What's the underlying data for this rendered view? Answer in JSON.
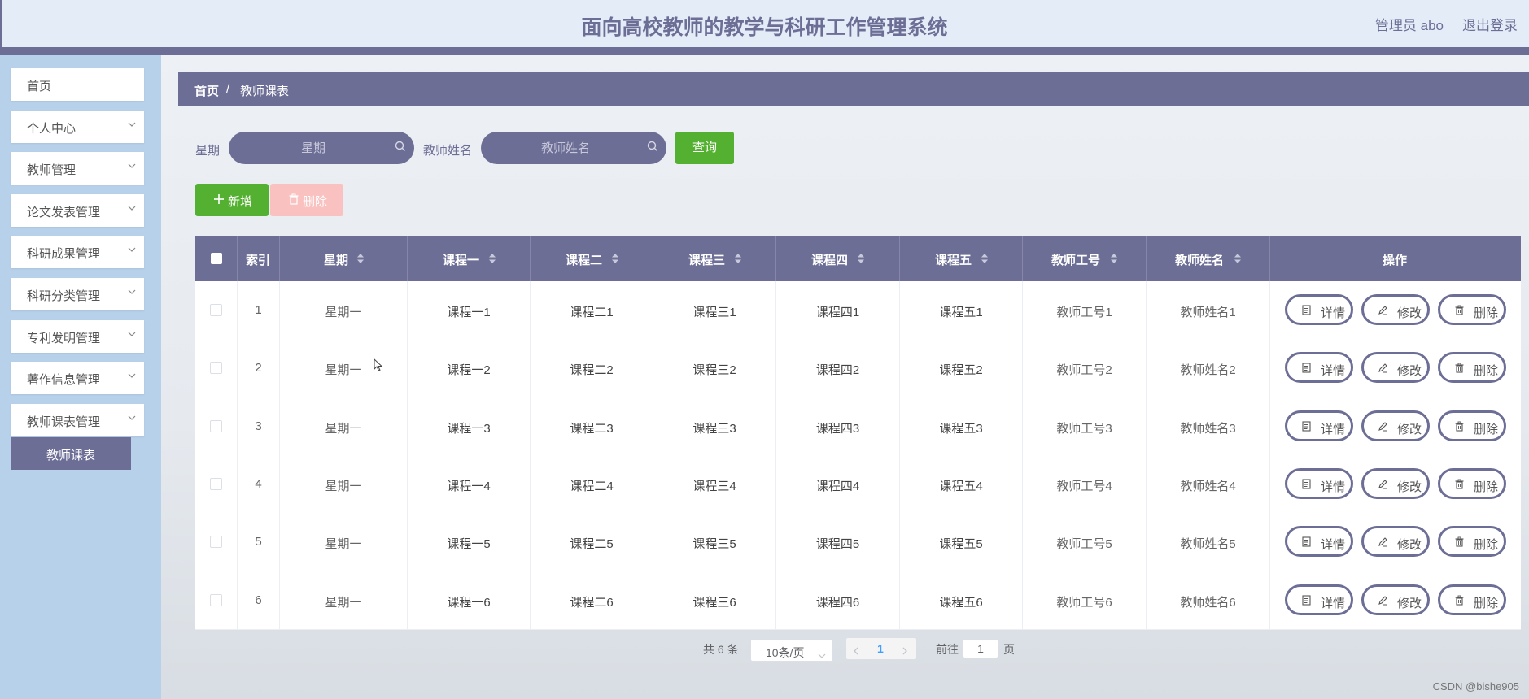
{
  "header": {
    "title": "面向高校教师的教学与科研工作管理系统",
    "admin_label": "管理员 abo",
    "logout": "退出登录"
  },
  "sidebar": {
    "items": [
      {
        "label": "首页",
        "has_arrow": false
      },
      {
        "label": "个人中心",
        "has_arrow": true
      },
      {
        "label": "教师管理",
        "has_arrow": true
      },
      {
        "label": "论文发表管理",
        "has_arrow": true
      },
      {
        "label": "科研成果管理",
        "has_arrow": true
      },
      {
        "label": "科研分类管理",
        "has_arrow": true
      },
      {
        "label": "专利发明管理",
        "has_arrow": true
      },
      {
        "label": "著作信息管理",
        "has_arrow": true
      },
      {
        "label": "教师课表管理",
        "has_arrow": true
      }
    ],
    "active_submenu": "教师课表"
  },
  "breadcrumb": {
    "home": "首页",
    "separator": "/",
    "current": "教师课表"
  },
  "search": {
    "weekday_label": "星期",
    "weekday_placeholder": "星期",
    "teacher_label": "教师姓名",
    "teacher_placeholder": "教师姓名",
    "query_button": "查询"
  },
  "toolbar": {
    "add_label": "新增",
    "delete_label": "删除"
  },
  "table": {
    "columns": [
      "索引",
      "星期",
      "课程一",
      "课程二",
      "课程三",
      "课程四",
      "课程五",
      "教师工号",
      "教师姓名",
      "操作"
    ],
    "rows": [
      {
        "index": "1",
        "weekday": "星期一",
        "c1": "课程一1",
        "c2": "课程二1",
        "c3": "课程三1",
        "c4": "课程四1",
        "c5": "课程五1",
        "tid": "教师工号1",
        "tname": "教师姓名1"
      },
      {
        "index": "2",
        "weekday": "星期一",
        "c1": "课程一2",
        "c2": "课程二2",
        "c3": "课程三2",
        "c4": "课程四2",
        "c5": "课程五2",
        "tid": "教师工号2",
        "tname": "教师姓名2"
      },
      {
        "index": "3",
        "weekday": "星期一",
        "c1": "课程一3",
        "c2": "课程二3",
        "c3": "课程三3",
        "c4": "课程四3",
        "c5": "课程五3",
        "tid": "教师工号3",
        "tname": "教师姓名3"
      },
      {
        "index": "4",
        "weekday": "星期一",
        "c1": "课程一4",
        "c2": "课程二4",
        "c3": "课程三4",
        "c4": "课程四4",
        "c5": "课程五4",
        "tid": "教师工号4",
        "tname": "教师姓名4"
      },
      {
        "index": "5",
        "weekday": "星期一",
        "c1": "课程一5",
        "c2": "课程二5",
        "c3": "课程三5",
        "c4": "课程四5",
        "c5": "课程五5",
        "tid": "教师工号5",
        "tname": "教师姓名5"
      },
      {
        "index": "6",
        "weekday": "星期一",
        "c1": "课程一6",
        "c2": "课程二6",
        "c3": "课程三6",
        "c4": "课程四6",
        "c5": "课程五6",
        "tid": "教师工号6",
        "tname": "教师姓名6"
      }
    ],
    "actions": {
      "detail": "详情",
      "edit": "修改",
      "delete": "删除"
    }
  },
  "pagination": {
    "total": "共 6 条",
    "page_size": "10条/页",
    "current_page": "1",
    "goto_label": "前往",
    "goto_value": "1",
    "page_unit": "页"
  },
  "watermark": "CSDN @bishe905",
  "colors": {
    "primary": "#6d6e96",
    "success": "#54b030",
    "danger_light": "#f9c2c0",
    "header_bg": "#e4edf7",
    "sidebar_bg": "#b8d1eb"
  }
}
